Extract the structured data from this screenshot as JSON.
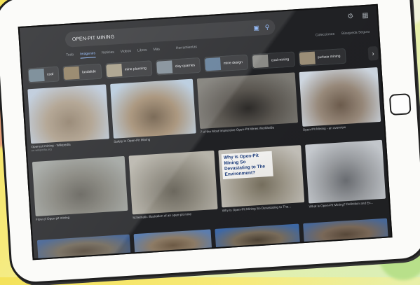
{
  "search": {
    "query": "OPEN-PIT MINING"
  },
  "tabs": [
    {
      "label": "Todo",
      "active": false
    },
    {
      "label": "Imágenes",
      "active": true
    },
    {
      "label": "Noticias",
      "active": false
    },
    {
      "label": "Videos",
      "active": false
    },
    {
      "label": "Libros",
      "active": false
    },
    {
      "label": "Más",
      "active": false
    }
  ],
  "tools_label": "Herramientas",
  "header_links": [
    "Colecciones",
    "Búsqueda Segura"
  ],
  "chips": [
    {
      "label": "coal",
      "color": "#6b7f8c"
    },
    {
      "label": "landslide",
      "color": "#8c7a5c"
    },
    {
      "label": "mine planning",
      "color": "#a49b84"
    },
    {
      "label": "clay quarries",
      "color": "#7d8a94"
    },
    {
      "label": "mine design",
      "color": "#5e7a96"
    },
    {
      "label": "coal mining",
      "color": "#8a8a86"
    },
    {
      "label": "surface mining",
      "color": "#9c8f78"
    }
  ],
  "results": [
    {
      "title": "Opencut mining - Wikipedia",
      "source": "en.wikipedia.org",
      "colors": [
        "#b9c7d8",
        "#a99a86",
        "#8c7b66"
      ]
    },
    {
      "title": "Safety in Open-Pit Mining",
      "source": "",
      "colors": [
        "#b5c9dc",
        "#a18b70",
        "#6b5944"
      ]
    },
    {
      "title": "7 of the Most Impressive Open-Pit Mines Worldwide",
      "source": "",
      "colors": [
        "#7c7a74",
        "#5a5650",
        "#2c2a28"
      ]
    },
    {
      "title": "Open-Pit Mining - an overview",
      "source": "",
      "colors": [
        "#cfd8e2",
        "#9a8b7c",
        "#6e5d4e"
      ]
    },
    {
      "title": "Flow of Open pit mining",
      "source": "",
      "colors": [
        "#9ea29e",
        "#7f7e76",
        "#5e5c55"
      ]
    },
    {
      "title": "Schematic illustration of an open-pit mine",
      "source": "",
      "colors": [
        "#b7b4aa",
        "#8f8b80",
        "#6c685e"
      ]
    },
    {
      "title": "Why is Open-Pit Mining So Devastating to The...",
      "source": "",
      "colors": [
        "#c4c1ba",
        "#9e988a",
        "#77705f"
      ],
      "overlay": "Why is Open-Pit Mining So Devastating to The Environment?"
    },
    {
      "title": "What is Open-Pit Mining? Definition and Ex...",
      "source": "",
      "colors": [
        "#c9cdd2",
        "#9c9fa3",
        "#6c6f74"
      ]
    },
    {
      "title": "",
      "source": "",
      "colors": [
        "#3c5b8c",
        "#6d6455",
        "#4f4234"
      ]
    },
    {
      "title": "",
      "source": "",
      "colors": [
        "#5d7fb0",
        "#8e7c66",
        "#6d5a45"
      ]
    },
    {
      "title": "",
      "source": "",
      "colors": [
        "#3f6aa8",
        "#7b6e5c",
        "#4e4335"
      ]
    },
    {
      "title": "",
      "source": "",
      "colors": [
        "#4c6c9c",
        "#7e6c5b",
        "#5b4b3c"
      ]
    }
  ]
}
